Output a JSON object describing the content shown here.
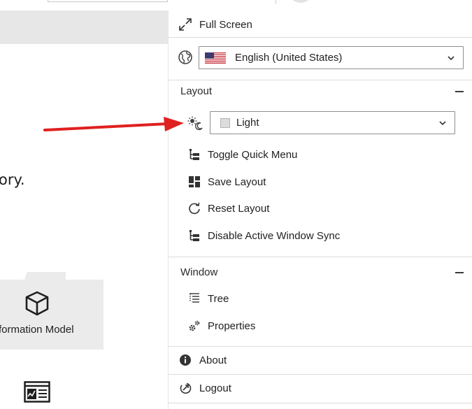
{
  "background": {
    "partial_text": "ory.",
    "card_label": "formation Model",
    "card_icon": "cube-icon",
    "bottom_icon": "dashboard-icon"
  },
  "menu": {
    "full_screen": {
      "label": "Full Screen",
      "icon": "expand-icon"
    },
    "language": {
      "icon": "globe-icon",
      "flag": "us-flag-icon",
      "selected": "English (United States)"
    },
    "layout_section": {
      "title": "Layout",
      "theme": {
        "icon": "sun-moon-icon",
        "selected": "Light",
        "swatch_color": "#dcdcdc"
      },
      "items": [
        {
          "label": "Toggle Quick Menu",
          "icon": "hierarchy-icon"
        },
        {
          "label": "Save Layout",
          "icon": "layout-grid-icon"
        },
        {
          "label": "Reset Layout",
          "icon": "reset-icon"
        },
        {
          "label": "Disable Active Window Sync",
          "icon": "hierarchy-icon"
        }
      ]
    },
    "window_section": {
      "title": "Window",
      "items": [
        {
          "label": "Tree",
          "icon": "tree-list-icon"
        },
        {
          "label": "Properties",
          "icon": "gears-icon"
        }
      ]
    },
    "about": {
      "label": "About",
      "icon": "info-icon"
    },
    "logout": {
      "label": "Logout",
      "icon": "logout-icon"
    }
  },
  "annotation": {
    "color": "#e02020"
  }
}
